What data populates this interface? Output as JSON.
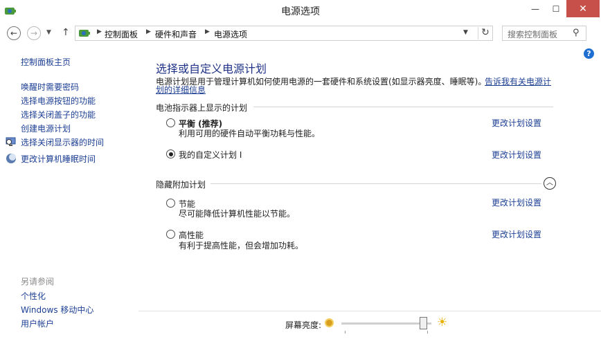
{
  "window": {
    "title": "电源选项",
    "minimize_glyph": "—",
    "maximize_glyph": "☐",
    "close_glyph": "✕"
  },
  "nav": {
    "back_glyph": "←",
    "forward_glyph": "→",
    "recent_glyph": "▼",
    "up_glyph": "↑",
    "breadcrumbs": [
      "控制面板",
      "硬件和声音",
      "电源选项"
    ],
    "separator": "▶",
    "dropdown_glyph": "▼",
    "refresh_glyph": "↻",
    "search_placeholder": "搜索控制面板",
    "search_glyph": "⚲",
    "help_glyph": "?"
  },
  "sidebar": {
    "home": "控制面板主页",
    "items": [
      "唤醒时需要密码",
      "选择电源按钮的功能",
      "选择关闭盖子的功能",
      "创建电源计划",
      "选择关闭显示器的时间",
      "更改计算机睡眠时间"
    ],
    "see_also_heading": "另请参阅",
    "see_also": [
      "个性化",
      "Windows 移动中心",
      "用户帐户"
    ]
  },
  "main": {
    "title": "选择或自定义电源计划",
    "description": "电源计划是用于管理计算机如何使用电源的一套硬件和系统设置(如显示器亮度、睡眠等)。",
    "learn_more_1": "告诉我有关电源计",
    "learn_more_2": "划的详细信息",
    "group1_heading": "电池指示器上显示的计划",
    "group2_heading": "隐藏附加计划",
    "collapse_glyph": "︿",
    "change_label": "更改计划设置",
    "plans": [
      {
        "name": "平衡 (推荐)",
        "desc": "利用可用的硬件自动平衡功耗与性能。",
        "selected": false
      },
      {
        "name": "我的自定义计划 I",
        "desc": "",
        "selected": true
      },
      {
        "name": "节能",
        "desc": "尽可能降低计算机性能以节能。",
        "selected": false
      },
      {
        "name": "高性能",
        "desc": "有利于提高性能，但会增加功耗。",
        "selected": false
      }
    ]
  },
  "brightness": {
    "label": "屏幕亮度:",
    "value_fraction": 0.95,
    "bright_glyph": "☀"
  },
  "colors": {
    "link": "#1c3f94",
    "title": "#1e3287",
    "close_button": "#c7504a",
    "help": "#1e6fd0"
  }
}
